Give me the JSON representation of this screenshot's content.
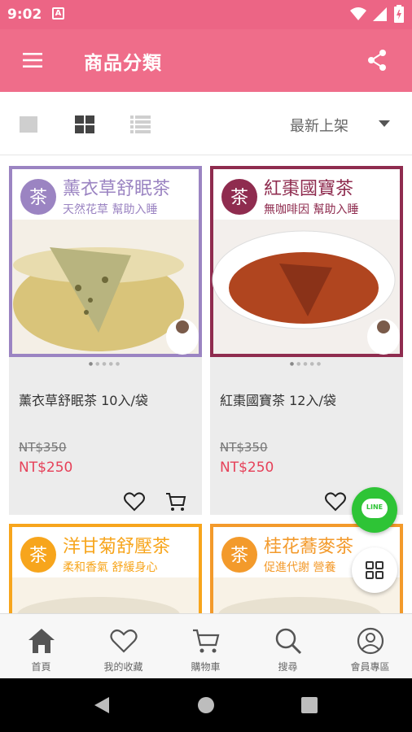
{
  "status_bar": {
    "time": "9:02",
    "notification_icon": "A"
  },
  "header": {
    "title": "商品分類",
    "menu_icon": "menu-icon",
    "share_icon": "share-icon"
  },
  "toolbar": {
    "sort_label": "最新上架"
  },
  "products": [
    {
      "name": "薰衣草舒眠茶 10入/袋",
      "old_price": "NT$350",
      "price": "NT$250",
      "banner_title": "薰衣草舒眠茶",
      "banner_subtitle": "天然花草  幫助入睡",
      "badge": "茶",
      "accent": "#9b84c2"
    },
    {
      "name": "紅棗國寶茶 12入/袋",
      "old_price": "NT$350",
      "price": "NT$250",
      "banner_title": "紅棗國寶茶",
      "banner_subtitle": "無咖啡因  幫助入睡",
      "badge": "茶",
      "accent": "#8f2c4f"
    },
    {
      "banner_title": "洋甘菊舒壓茶",
      "banner_subtitle": "柔和香氣  舒緩身心",
      "badge": "茶",
      "accent": "#f7a51c"
    },
    {
      "banner_title": "桂花蕎麥茶",
      "banner_subtitle": "促進代謝  營養",
      "badge": "茶",
      "accent": "#f39a2b"
    }
  ],
  "fab": {
    "line_label": "LINE"
  },
  "bottom_nav": [
    {
      "label": "首頁",
      "icon": "home-icon"
    },
    {
      "label": "我的收藏",
      "icon": "heart-icon"
    },
    {
      "label": "購物車",
      "icon": "cart-icon"
    },
    {
      "label": "搜尋",
      "icon": "search-icon"
    },
    {
      "label": "會員專區",
      "icon": "user-icon"
    }
  ],
  "colors": {
    "brand": "#ef6d8a",
    "status_bar": "#ec6585",
    "price": "#e64159",
    "line_green": "#2ec436"
  }
}
